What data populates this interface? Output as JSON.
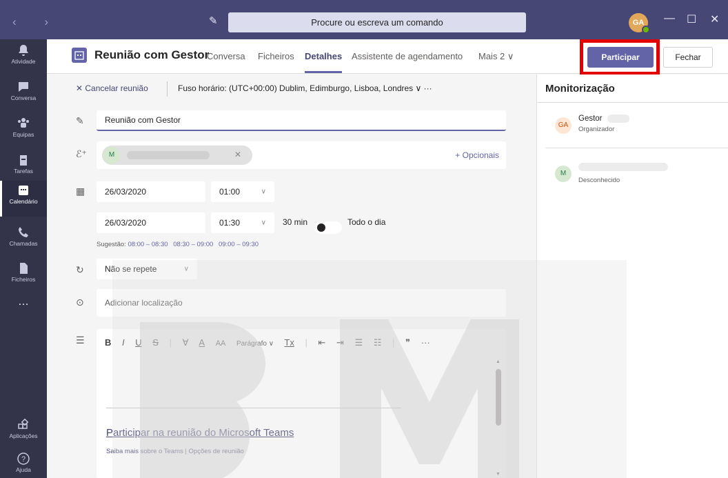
{
  "titlebar": {
    "search_placeholder": "Procure ou escreva um comando",
    "avatar_initials": "GA",
    "minimize": "—",
    "maximize": "☐",
    "close": "✕"
  },
  "rail": [
    {
      "label": "Atividade",
      "icon": "bell-icon"
    },
    {
      "label": "Conversa",
      "icon": "chat-icon"
    },
    {
      "label": "Equipas",
      "icon": "teams-icon"
    },
    {
      "label": "Tarefas",
      "icon": "tasks-icon"
    },
    {
      "label": "Calendário",
      "icon": "calendar-icon",
      "active": true
    },
    {
      "label": "Chamadas",
      "icon": "phone-icon"
    },
    {
      "label": "Ficheiros",
      "icon": "file-icon"
    },
    {
      "label": "…",
      "icon": "more-icon"
    },
    {
      "label": "Aplicações",
      "icon": "apps-icon"
    },
    {
      "label": "Ajuda",
      "icon": "help-icon"
    }
  ],
  "header": {
    "title": "Reunião com Gestor",
    "tabs": [
      "Conversa",
      "Ficheiros",
      "Detalhes",
      "Assistente de agendamento",
      "Mais 2 ∨"
    ],
    "active_tab": "Detalhes",
    "join_label": "Participar",
    "close_label": "Fechar"
  },
  "subbar": {
    "cancel_label": "✕  Cancelar reunião",
    "timezone": "Fuso horário: (UTC+00:00) Dublim, Edimburgo, Lisboa, Londres  ∨   ···"
  },
  "form": {
    "title_value": "Reunião com Gestor",
    "attendee_initial": "M",
    "optional_label": "+ Opcionais",
    "start_date": "26/03/2020",
    "start_time": "01:00",
    "end_date": "26/03/2020",
    "end_time": "01:30",
    "duration": "30 min",
    "all_day_label": "Todo o dia",
    "suggestion_label": "Sugestão:",
    "suggestions": [
      "08:00 – 08:30",
      "08:30 – 09:00",
      "09:00 – 09:30"
    ],
    "repeat_value": "Não se repete",
    "location_placeholder": "Adicionar localização"
  },
  "editor": {
    "toolbar": [
      "B",
      "I",
      "U",
      "S",
      "|",
      "∀",
      "A",
      "AA",
      "Parágrafo ∨",
      "Tx",
      "|",
      "⇤",
      "⇥",
      "☰",
      "☷",
      "|",
      "❞",
      "···"
    ],
    "meeting_link": "Participar na reunião do Microsoft Teams",
    "learn_more": "Saiba mais sobre o Teams",
    "meeting_options": "Opções de reunião",
    "separator": " | "
  },
  "tracking": {
    "title": "Monitorização",
    "people": [
      {
        "initials": "GA",
        "name": "Gestor",
        "role": "Organizador"
      },
      {
        "initials": "M",
        "name": "",
        "role": "Desconhecido"
      }
    ]
  },
  "colors": {
    "accent": "#6264a7",
    "titlebar": "#464775",
    "rail": "#33344a",
    "highlight": "#e40000"
  }
}
